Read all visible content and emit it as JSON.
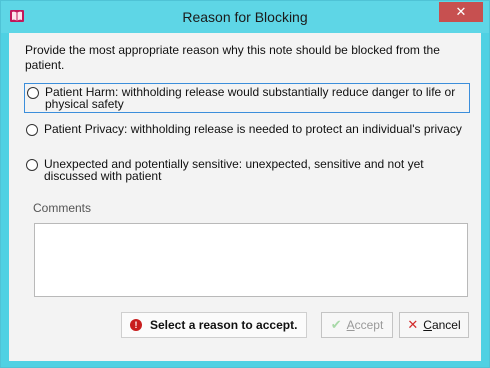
{
  "window": {
    "title": "Reason for Blocking",
    "close_glyph": "✕"
  },
  "prompt": "Provide the most appropriate reason why this note should be blocked from the patient.",
  "options": [
    {
      "label": "Patient Harm: withholding release would substantially reduce danger to life or physical safety",
      "selected": false,
      "focused": true
    },
    {
      "label": "Patient Privacy: withholding release is needed to protect an individual's privacy",
      "selected": false,
      "focused": false
    },
    {
      "label": "Unexpected and potentially sensitive: unexpected, sensitive and not yet discussed with patient",
      "selected": false,
      "focused": false
    }
  ],
  "comments": {
    "label": "Comments",
    "value": ""
  },
  "status": {
    "message": "Select a reason to accept.",
    "icon": "warning-icon",
    "color": "#c81e1e"
  },
  "buttons": {
    "accept": {
      "first_letter": "A",
      "rest": "ccept",
      "enabled": false,
      "icon": "check-icon"
    },
    "cancel": {
      "first_letter": "C",
      "rest": "ancel",
      "enabled": true,
      "icon": "x-icon"
    }
  },
  "colors": {
    "titlebar": "#5ed6e6",
    "close": "#c75050",
    "focus_border": "#3b8edb"
  }
}
